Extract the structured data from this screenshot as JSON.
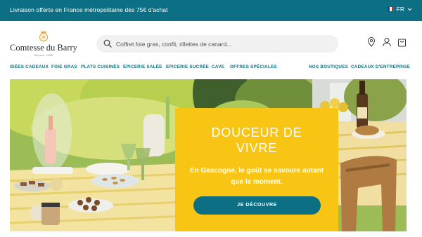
{
  "topbar": {
    "promo_text": "Livraison offerte en France métropolitaine dès 75€ d'achat",
    "language": "FR",
    "flag_colors": [
      "#1e3a8a",
      "#ffffff",
      "#dc2626"
    ]
  },
  "header": {
    "logo": {
      "brand": "Comtesse du Barry",
      "tagline": "Depuis 1908"
    },
    "search": {
      "placeholder": "Coffret foie gras, confit, rillettes de canard..."
    },
    "icons": [
      "location-pin-icon",
      "user-icon",
      "cart-icon"
    ]
  },
  "nav": {
    "main": [
      "IDÉES CADEAUX",
      "FOIE GRAS",
      "PLATS CUISINÉS",
      "EPICERIE SALÉE",
      "EPICERIE SUCRÉE",
      "CAVE",
      "OFFRES SPÉCIALES"
    ],
    "secondary": [
      "NOS BOUTIQUES",
      "CADEAUX D'ENTREPRISE"
    ]
  },
  "hero": {
    "title_line1": "DOUCEUR DE",
    "title_line2": "VIVRE",
    "subtitle": "En Gascogne, le goût se savoure autant que le moment.",
    "cta_label": "JE DÉCOUVRE"
  },
  "colors": {
    "brand": "#0d6f84",
    "promo_card": "#f9c514",
    "text_dark": "#1f2a33"
  }
}
